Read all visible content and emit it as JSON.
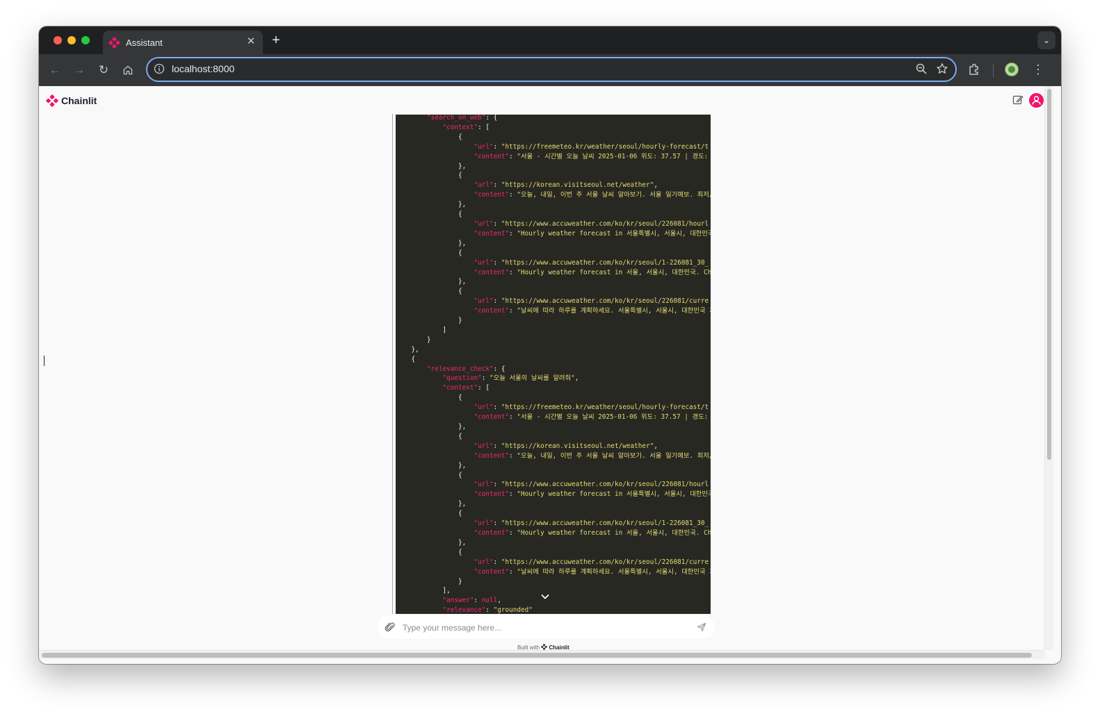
{
  "browser": {
    "tab_title": "Assistant",
    "new_tab_symbol": "+",
    "url": "localhost:8000"
  },
  "app": {
    "name": "Chainlit",
    "brand_color": "#f0146c"
  },
  "code_block": {
    "lines": [
      [
        [
          "        ",
          ""
        ],
        [
          "\"search_on_web\"",
          "k"
        ],
        [
          ": {",
          ""
        ]
      ],
      [
        [
          "            ",
          ""
        ],
        [
          "\"context\"",
          "k"
        ],
        [
          ": [",
          ""
        ]
      ],
      [
        [
          "                {",
          ""
        ]
      ],
      [
        [
          "                    ",
          ""
        ],
        [
          "\"url\"",
          "k"
        ],
        [
          ": ",
          ""
        ],
        [
          "\"https://freemeteo.kr/weather/seoul/hourly-forecast/t",
          "s"
        ]
      ],
      [
        [
          "                    ",
          ""
        ],
        [
          "\"content\"",
          "k"
        ],
        [
          ": ",
          ""
        ],
        [
          "\"서울 - 시간별 오늘 날씨 2025-01-06 위도: 37.57 | 경도: ",
          "s"
        ]
      ],
      [
        [
          "                },",
          ""
        ]
      ],
      [
        [
          "                {",
          ""
        ]
      ],
      [
        [
          "                    ",
          ""
        ],
        [
          "\"url\"",
          "k"
        ],
        [
          ": ",
          ""
        ],
        [
          "\"https://korean.visitseoul.net/weather\"",
          "s"
        ],
        [
          ",",
          ""
        ]
      ],
      [
        [
          "                    ",
          ""
        ],
        [
          "\"content\"",
          "k"
        ],
        [
          ": ",
          ""
        ],
        [
          "\"오늘, 내일, 이번 주 서울 날씨 알아보기. 서울 일기예보. 최저/최",
          "s"
        ]
      ],
      [
        [
          "                },",
          ""
        ]
      ],
      [
        [
          "                {",
          ""
        ]
      ],
      [
        [
          "                    ",
          ""
        ],
        [
          "\"url\"",
          "k"
        ],
        [
          ": ",
          ""
        ],
        [
          "\"https://www.accuweather.com/ko/kr/seoul/226081/hourl",
          "s"
        ]
      ],
      [
        [
          "                    ",
          ""
        ],
        [
          "\"content\"",
          "k"
        ],
        [
          ": ",
          ""
        ],
        [
          "\"Hourly weather forecast in 서울특별시, 서울시, 대한민국",
          "s"
        ]
      ],
      [
        [
          "                },",
          ""
        ]
      ],
      [
        [
          "                {",
          ""
        ]
      ],
      [
        [
          "                    ",
          ""
        ],
        [
          "\"url\"",
          "k"
        ],
        [
          ": ",
          ""
        ],
        [
          "\"https://www.accuweather.com/ko/kr/seoul/1-226081_30_",
          "s"
        ]
      ],
      [
        [
          "                    ",
          ""
        ],
        [
          "\"content\"",
          "k"
        ],
        [
          ": ",
          ""
        ],
        [
          "\"Hourly weather forecast in 서울, 서울시, 대한민국. Ch",
          "s"
        ]
      ],
      [
        [
          "                },",
          ""
        ]
      ],
      [
        [
          "                {",
          ""
        ]
      ],
      [
        [
          "                    ",
          ""
        ],
        [
          "\"url\"",
          "k"
        ],
        [
          ": ",
          ""
        ],
        [
          "\"https://www.accuweather.com/ko/kr/seoul/226081/curre",
          "s"
        ]
      ],
      [
        [
          "                    ",
          ""
        ],
        [
          "\"content\"",
          "k"
        ],
        [
          ": ",
          ""
        ],
        [
          "\"날씨에 따라 하루를 계획하세요. 서울특별시, 서울시, 대한민국 지",
          "s"
        ]
      ],
      [
        [
          "                }",
          ""
        ]
      ],
      [
        [
          "            ]",
          ""
        ]
      ],
      [
        [
          "        }",
          ""
        ]
      ],
      [
        [
          "    },",
          ""
        ]
      ],
      [
        [
          "    {",
          ""
        ]
      ],
      [
        [
          "        ",
          ""
        ],
        [
          "\"relevance_check\"",
          "k"
        ],
        [
          ": {",
          ""
        ]
      ],
      [
        [
          "            ",
          ""
        ],
        [
          "\"question\"",
          "k"
        ],
        [
          ": ",
          ""
        ],
        [
          "\"오늘 서울의 날씨를 알려줘\"",
          "s"
        ],
        [
          ",",
          ""
        ]
      ],
      [
        [
          "            ",
          ""
        ],
        [
          "\"context\"",
          "k"
        ],
        [
          ": [",
          ""
        ]
      ],
      [
        [
          "                {",
          ""
        ]
      ],
      [
        [
          "                    ",
          ""
        ],
        [
          "\"url\"",
          "k"
        ],
        [
          ": ",
          ""
        ],
        [
          "\"https://freemeteo.kr/weather/seoul/hourly-forecast/t",
          "s"
        ]
      ],
      [
        [
          "                    ",
          ""
        ],
        [
          "\"content\"",
          "k"
        ],
        [
          ": ",
          ""
        ],
        [
          "\"서울 - 시간별 오늘 날씨 2025-01-06 위도: 37.57 | 경도: ",
          "s"
        ]
      ],
      [
        [
          "                },",
          ""
        ]
      ],
      [
        [
          "                {",
          ""
        ]
      ],
      [
        [
          "                    ",
          ""
        ],
        [
          "\"url\"",
          "k"
        ],
        [
          ": ",
          ""
        ],
        [
          "\"https://korean.visitseoul.net/weather\"",
          "s"
        ],
        [
          ",",
          ""
        ]
      ],
      [
        [
          "                    ",
          ""
        ],
        [
          "\"content\"",
          "k"
        ],
        [
          ": ",
          ""
        ],
        [
          "\"오늘, 내일, 이번 주 서울 날씨 알아보기. 서울 일기예보. 최저/최",
          "s"
        ]
      ],
      [
        [
          "                },",
          ""
        ]
      ],
      [
        [
          "                {",
          ""
        ]
      ],
      [
        [
          "                    ",
          ""
        ],
        [
          "\"url\"",
          "k"
        ],
        [
          ": ",
          ""
        ],
        [
          "\"https://www.accuweather.com/ko/kr/seoul/226081/hourl",
          "s"
        ]
      ],
      [
        [
          "                    ",
          ""
        ],
        [
          "\"content\"",
          "k"
        ],
        [
          ": ",
          ""
        ],
        [
          "\"Hourly weather forecast in 서울특별시, 서울시, 대한민국",
          "s"
        ]
      ],
      [
        [
          "                },",
          ""
        ]
      ],
      [
        [
          "                {",
          ""
        ]
      ],
      [
        [
          "                    ",
          ""
        ],
        [
          "\"url\"",
          "k"
        ],
        [
          ": ",
          ""
        ],
        [
          "\"https://www.accuweather.com/ko/kr/seoul/1-226081_30_",
          "s"
        ]
      ],
      [
        [
          "                    ",
          ""
        ],
        [
          "\"content\"",
          "k"
        ],
        [
          ": ",
          ""
        ],
        [
          "\"Hourly weather forecast in 서울, 서울시, 대한민국. Ch",
          "s"
        ]
      ],
      [
        [
          "                },",
          ""
        ]
      ],
      [
        [
          "                {",
          ""
        ]
      ],
      [
        [
          "                    ",
          ""
        ],
        [
          "\"url\"",
          "k"
        ],
        [
          ": ",
          ""
        ],
        [
          "\"https://www.accuweather.com/ko/kr/seoul/226081/curre",
          "s"
        ]
      ],
      [
        [
          "                    ",
          ""
        ],
        [
          "\"content\"",
          "k"
        ],
        [
          ": ",
          ""
        ],
        [
          "\"날씨에 따라 하루를 계획하세요. 서울특별시, 서울시, 대한민국 지",
          "s"
        ]
      ],
      [
        [
          "                }",
          ""
        ]
      ],
      [
        [
          "            ],",
          ""
        ]
      ],
      [
        [
          "            ",
          ""
        ],
        [
          "\"answer\"",
          "k"
        ],
        [
          ": ",
          ""
        ],
        [
          "null",
          "k"
        ],
        [
          ",",
          ""
        ]
      ],
      [
        [
          "            ",
          ""
        ],
        [
          "\"relevance\"",
          "k"
        ],
        [
          ": ",
          ""
        ],
        [
          "\"grounded\"",
          "s"
        ]
      ]
    ]
  },
  "composer": {
    "placeholder": "Type your message here..."
  },
  "footer": {
    "built_with": "Built with",
    "brand": "Chainlit"
  },
  "icons": {
    "tab_favicon": "chainlit-logo-icon",
    "tab_close": "close-icon",
    "nav_back": "arrow-left-icon",
    "nav_forward": "arrow-right-icon",
    "reload": "reload-icon",
    "home": "home-icon",
    "site_info": "info-icon",
    "zoom": "zoom-icon",
    "bookmark": "star-icon",
    "extensions": "puzzle-icon",
    "profile": "profile-icon",
    "menu": "kebab-menu-icon",
    "new_chat": "edit-icon",
    "user": "user-avatar-icon",
    "attach": "paperclip-icon",
    "send": "send-icon",
    "scroll_down": "chevron-down-icon"
  }
}
